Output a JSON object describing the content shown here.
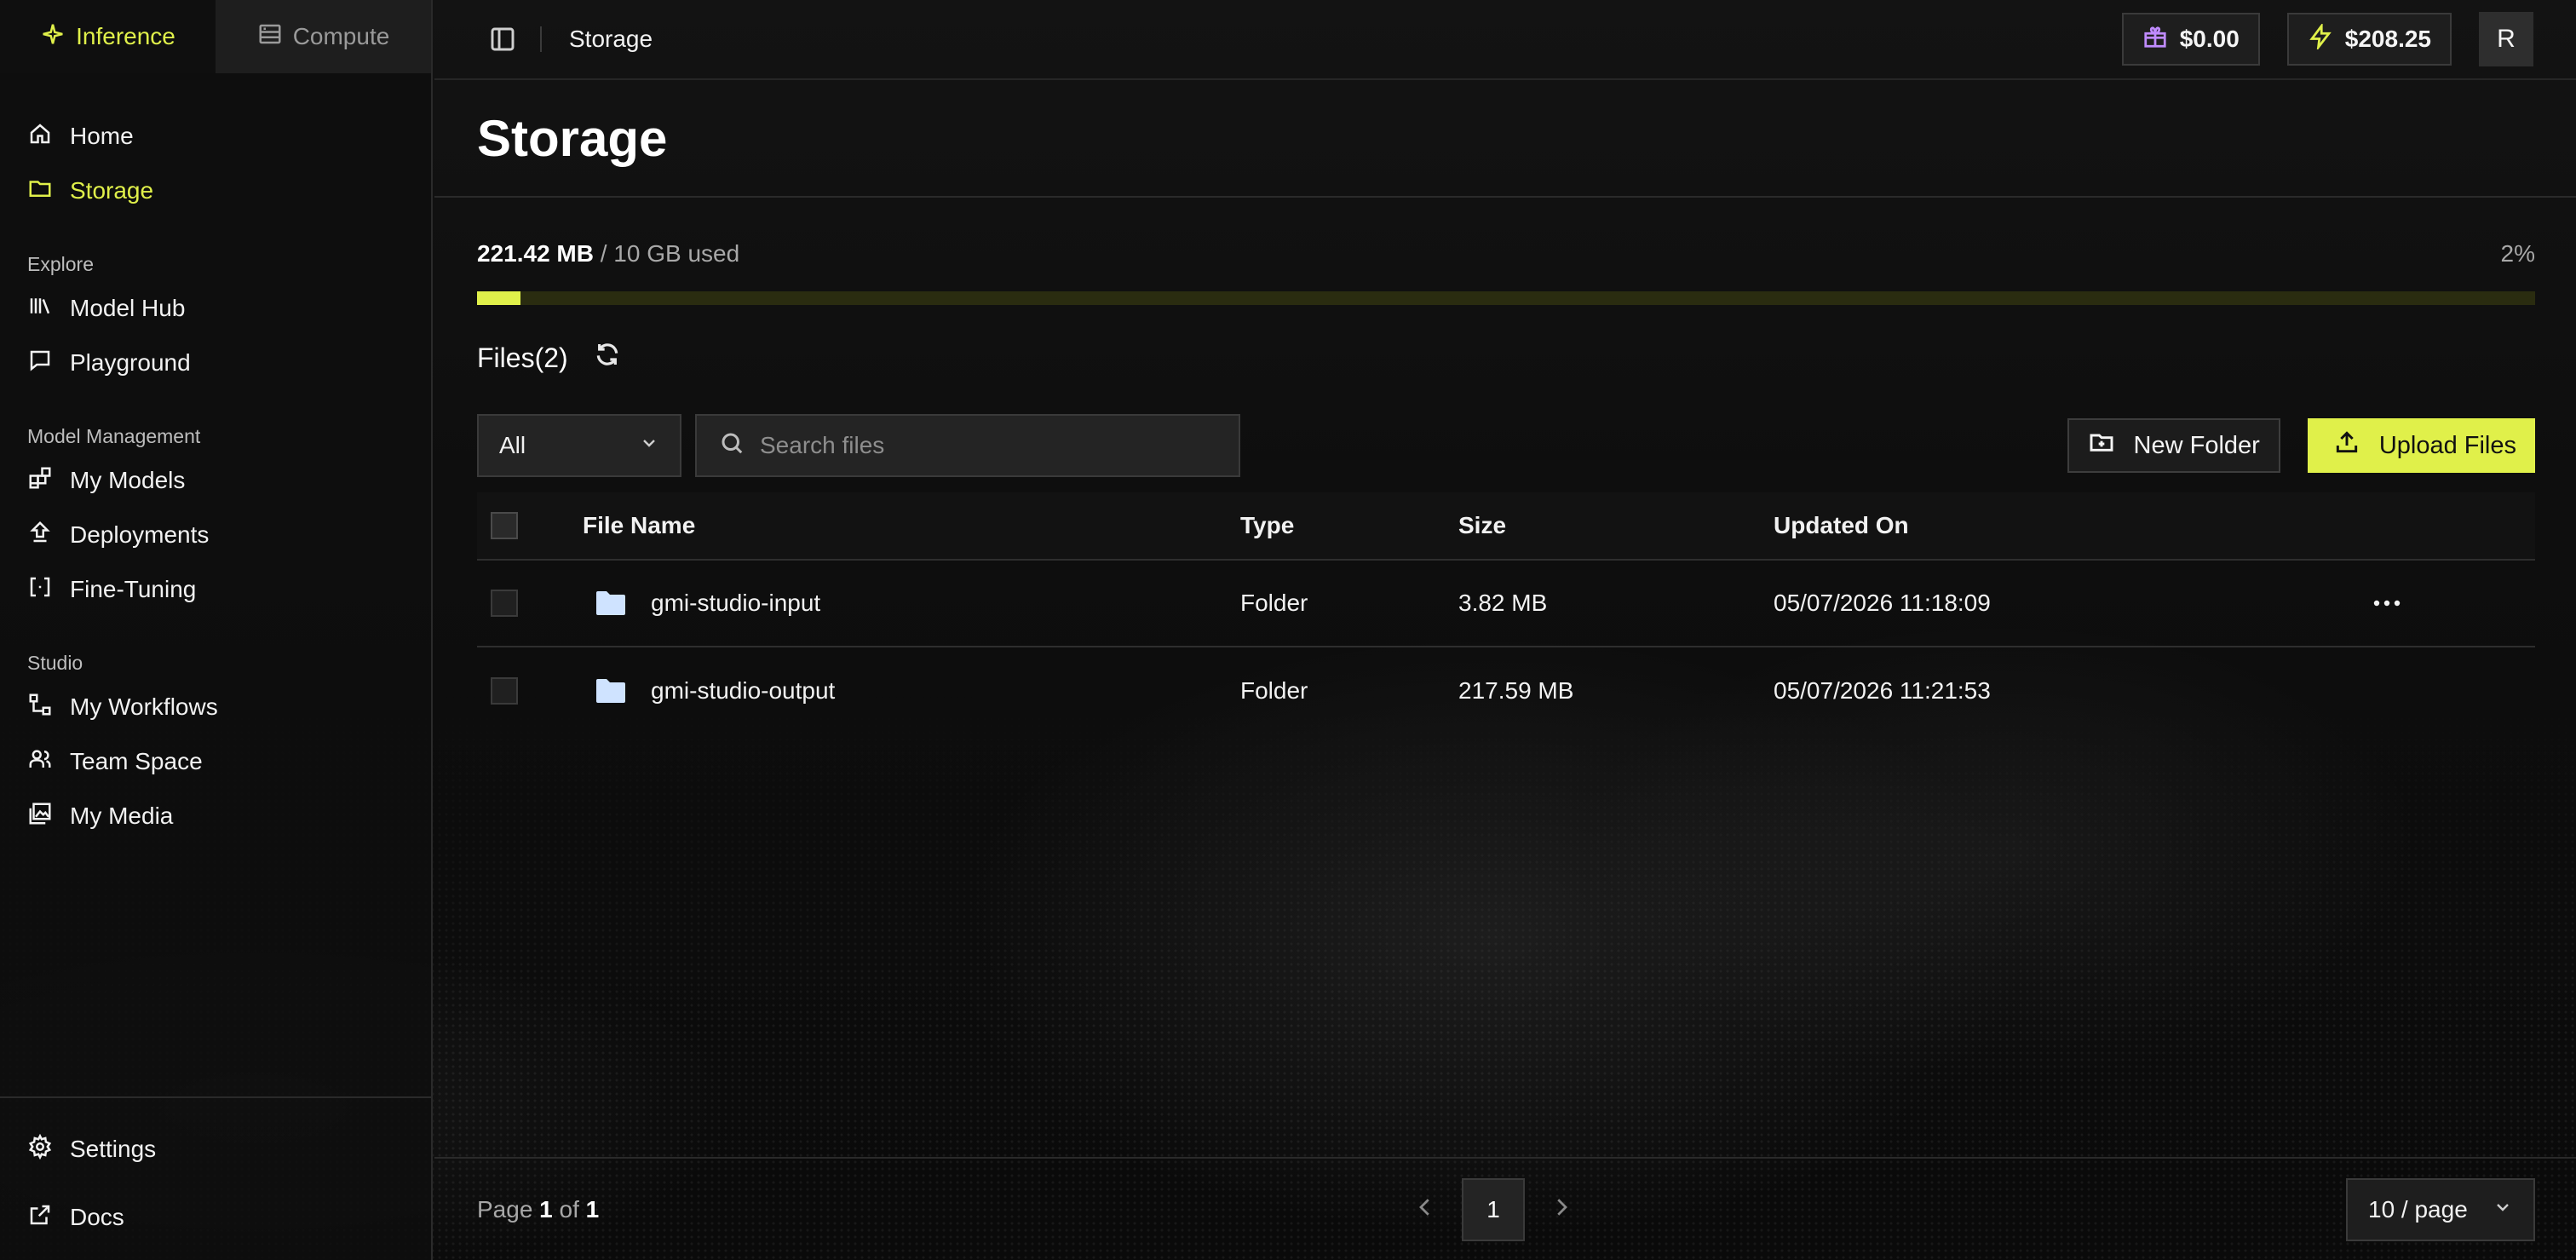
{
  "sidebar": {
    "modes": [
      {
        "label": "Inference",
        "icon": "sparkle-icon",
        "active": true
      },
      {
        "label": "Compute",
        "icon": "server-icon",
        "active": false
      }
    ],
    "primary": [
      {
        "label": "Home",
        "icon": "home-icon"
      },
      {
        "label": "Storage",
        "icon": "folder-icon",
        "active": true
      }
    ],
    "sections": [
      {
        "title": "Explore",
        "items": [
          {
            "label": "Model Hub",
            "icon": "library-icon"
          },
          {
            "label": "Playground",
            "icon": "message-square-icon"
          }
        ]
      },
      {
        "title": "Model Management",
        "items": [
          {
            "label": "My Models",
            "icon": "blocks-icon"
          },
          {
            "label": "Deployments",
            "icon": "deploy-icon"
          },
          {
            "label": "Fine-Tuning",
            "icon": "brackets-icon"
          }
        ]
      },
      {
        "title": "Studio",
        "items": [
          {
            "label": "My Workflows",
            "icon": "workflow-icon"
          },
          {
            "label": "Team Space",
            "icon": "users-icon"
          },
          {
            "label": "My Media",
            "icon": "images-icon"
          }
        ]
      }
    ],
    "bottom": [
      {
        "label": "Settings",
        "icon": "gear-icon"
      },
      {
        "label": "Docs",
        "icon": "external-link-icon"
      }
    ]
  },
  "topbar": {
    "breadcrumb": "Storage",
    "credits": "$0.00",
    "balance": "$208.25",
    "avatar_initial": "R"
  },
  "page": {
    "title": "Storage",
    "usage": {
      "used": "221.42 MB",
      "total": " / 10 GB used",
      "percent_label": "2%",
      "percent_value": 0.02
    },
    "files_heading": "Files(2)",
    "filter_value": "All",
    "search_placeholder": "Search files",
    "new_folder_label": "New Folder",
    "upload_label": "Upload Files"
  },
  "table": {
    "columns": [
      "File Name",
      "Type",
      "Size",
      "Updated On"
    ],
    "rows": [
      {
        "name": "gmi-studio-input",
        "type": "Folder",
        "size": "3.82 MB",
        "updated": "05/07/2026 11:18:09"
      },
      {
        "name": "gmi-studio-output",
        "type": "Folder",
        "size": "217.59 MB",
        "updated": "05/07/2026 11:21:53"
      }
    ]
  },
  "pagination": {
    "prefix": "Page ",
    "current": "1",
    "of": " of ",
    "total": "1",
    "page_button": "1",
    "per_page": "10 / page"
  },
  "colors": {
    "accent": "#e0f04a",
    "background": "#0d0d0d",
    "folder": "#cfe3ff"
  }
}
